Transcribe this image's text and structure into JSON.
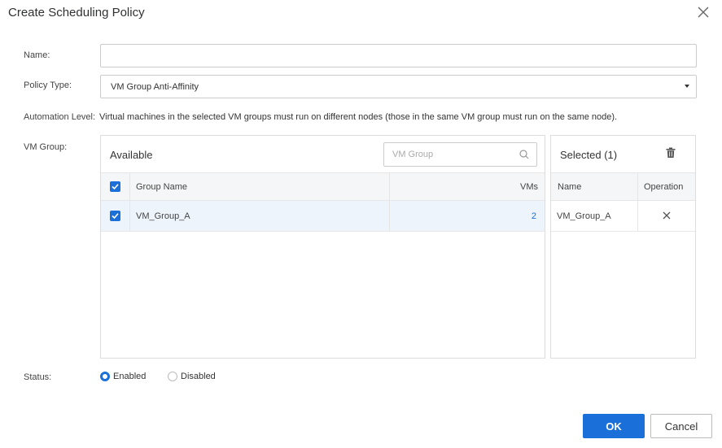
{
  "dialog": {
    "title": "Create Scheduling Policy"
  },
  "form": {
    "name_label": "Name:",
    "name_value": "",
    "policy_type_label": "Policy Type:",
    "policy_type_value": "VM Group Anti-Affinity",
    "automation_label": "Automation Level:",
    "automation_text": "Virtual machines in the selected VM groups must run on different nodes (those in the same VM group must run on the same node).",
    "vm_group_label": "VM Group:",
    "status_label": "Status:"
  },
  "available": {
    "title": "Available",
    "search_placeholder": "VM Group",
    "columns": {
      "group_name": "Group Name",
      "vms": "VMs"
    },
    "rows": [
      {
        "group_name": "VM_Group_A",
        "vms": "2",
        "checked": true
      }
    ],
    "select_all_checked": true
  },
  "selected": {
    "title": "Selected (1)",
    "columns": {
      "name": "Name",
      "operation": "Operation"
    },
    "rows": [
      {
        "name": "VM_Group_A"
      }
    ]
  },
  "status": {
    "options": [
      {
        "label": "Enabled",
        "selected": true
      },
      {
        "label": "Disabled",
        "selected": false
      }
    ]
  },
  "buttons": {
    "ok": "OK",
    "cancel": "Cancel"
  },
  "icons": {
    "close": "close-icon",
    "caret": "chevron-down-icon",
    "search": "search-icon",
    "trash": "trash-icon",
    "remove": "close-icon",
    "checkbox": "checkbox-checked-icon"
  },
  "colors": {
    "accent": "#1b6fd9",
    "header_bg": "#f5f6f8",
    "selected_row_bg": "#eef4fb"
  }
}
